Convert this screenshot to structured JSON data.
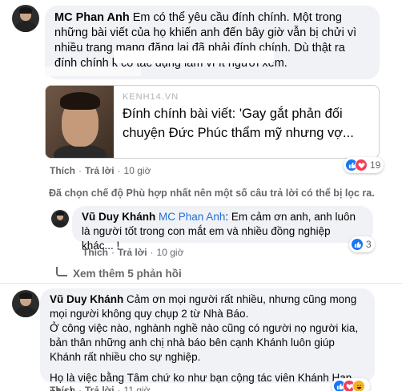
{
  "comments": {
    "c1": {
      "author": "MC Phan Anh",
      "text": "Em có thể yêu cầu đính chính. Một trong những bài viết của họ khiến anh đến bây giờ vẫn bị chửi vì nhiều trang mạng đăng lại đã phải đính chính. Dù thật ra đính chính k có tác dụng lắm vì ít người xem.",
      "link": {
        "domain": "KENH14.VN",
        "title": "Đính chính bài viết: 'Gay gắt phản đối chuyện Đức Phúc thẩm mỹ nhưng vợ..."
      },
      "like_label": "Thích",
      "reply_label": "Trả lời",
      "time": "10 giờ",
      "reaction_count": "19"
    },
    "filter_note": "Đã chọn chế độ Phù hợp nhất nên một số câu trả lời có thể bị lọc ra.",
    "reply1": {
      "author": "Vũ Duy Khánh",
      "mention": "MC Phan Anh",
      "text": ": Em cảm ơn anh, anh luôn là người tốt trong con mắt em và nhiều đồng nghiệp khác... !",
      "like_label": "Thích",
      "reply_label": "Trả lời",
      "time": "10 giờ",
      "reaction_count": "3"
    },
    "more_replies_label": "Xem thêm 5 phản hồi",
    "c2": {
      "author": "Vũ Duy Khánh",
      "para1": "Cảm ơn mọi người rất nhiều, nhưng cũng mong mọi người không quy chụp 2 từ Nhà Báo.",
      "para2": "Ở công việc nào, nghành nghề nào cũng có người nọ người kia, bản thân những anh chị nhà báo bên cạnh Khánh luôn giúp Khánh rất nhiều cho sự nghiệp.",
      "para3": "Họ là việc bằng Tâm chứ ko như bạn cộng tác viên Khánh Hạn này !",
      "like_label": "Thích",
      "reply_label": "Trả lời",
      "time": "11 giờ"
    }
  },
  "colors": {
    "like": "#1877f2",
    "love": "#f33e58",
    "haha": "#f7b125",
    "bubble": "#f0f2f5",
    "meta": "#65676b",
    "mention": "#216fdb"
  },
  "icons": [
    "like-reaction-icon",
    "love-reaction-icon",
    "haha-reaction-icon",
    "reply-arrow-icon"
  ]
}
